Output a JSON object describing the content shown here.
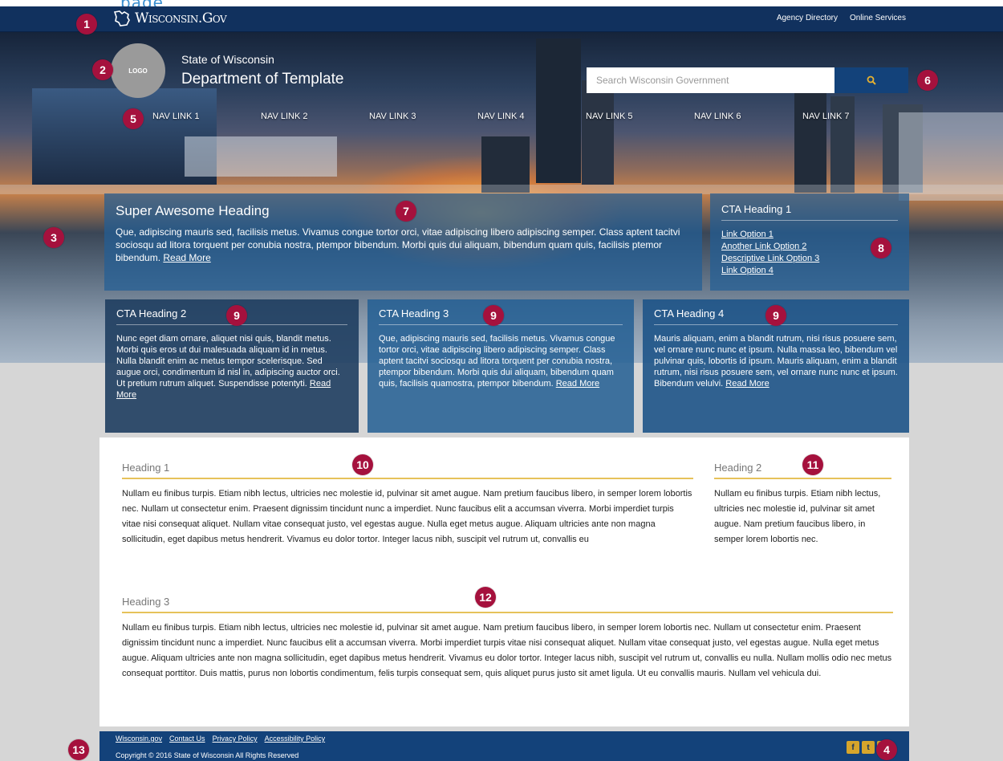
{
  "colors": {
    "top_bar": "#11315e",
    "accent_blue": "#13427a",
    "marker": "#a5113d",
    "heading_rule": "#e6c25a",
    "social_icon": "#d6a52b"
  },
  "brand": {
    "name": "Wisconsin.Gov",
    "icon": "wisconsin-state-outline-icon"
  },
  "top_links": [
    "Agency Directory",
    "Online Services"
  ],
  "header": {
    "logo_text": "LOGO",
    "state_name": "State of Wisconsin",
    "dept_name": "Department of Template"
  },
  "search": {
    "placeholder": "Search Wisconsin Government",
    "icon": "search-icon"
  },
  "nav": [
    "NAV LINK 1",
    "NAV LINK 2",
    "NAV LINK 3",
    "NAV LINK 4",
    "NAV LINK 5",
    "NAV LINK 6",
    "NAV LINK 7"
  ],
  "hero_panel": {
    "heading": "Super Awesome Heading",
    "body": "Que, adipiscing mauris sed, facilisis metus. Vivamus congue tortor orci, vitae adipiscing libero adipiscing semper. Class aptent tacitvi sociosqu ad litora torquent per conubia nostra, ptempor bibendum. Morbi quis dui aliquam, bibendum quam quis, facilisis ptemor bibendum. ",
    "read_more": "Read More"
  },
  "cta1": {
    "heading": "CTA Heading 1",
    "links": [
      "Link Option 1",
      "Another Link Option 2",
      "Descriptive Link Option 3",
      "Link Option 4"
    ]
  },
  "cta_cards": [
    {
      "heading": "CTA Heading 2",
      "body": "Nunc eget diam ornare, aliquet nisi quis, blandit metus. Morbi quis eros ut dui malesuada aliquam id in metus. Nulla blandit enim ac metus tempor scelerisque. Sed augue orci, condimentum id nisl in, adipiscing auctor orci. Ut pretium rutrum aliquet. Suspendisse potentyti. ",
      "read_more": "Read More"
    },
    {
      "heading": "CTA Heading 3",
      "body": "Que, adipiscing mauris sed, facilisis metus. Vivamus congue tortor orci, vitae adipiscing libero adipiscing semper. Class aptent tacitvi sociosqu ad litora torquent per conubia nostra, ptempor bibendum. Morbi quis dui aliquam, bibendum quam quis, facilisis quamostra, ptempor bibendum. ",
      "read_more": "Read More"
    },
    {
      "heading": "CTA Heading 4",
      "body": "Mauris aliquam, enim a blandit rutrum, nisi risus posuere sem, vel ornare nunc nunc et ipsum. Nulla massa leo, bibendum vel pulvinar quis, lobortis id ipsum. Mauris aliquam, enim a blandit rutrum, nisi risus posuere sem, vel ornare nunc nunc et ipsum. Bibendum velulvi. ",
      "read_more": "Read More"
    }
  ],
  "content": {
    "section1": {
      "heading": "Heading 1",
      "body": "Nullam eu finibus turpis. Etiam nibh lectus, ultricies nec molestie id, pulvinar sit amet augue. Nam pretium faucibus libero, in semper lorem lobortis nec. Nullam ut consectetur enim. Praesent dignissim tincidunt nunc a imperdiet. Nunc faucibus elit a accumsan viverra. Morbi imperdiet turpis vitae nisi consequat aliquet. Nullam vitae consequat justo, vel egestas augue. Nulla eget metus augue. Aliquam ultricies ante non magna sollicitudin, eget dapibus metus hendrerit. Vivamus eu dolor tortor. Integer lacus nibh, suscipit vel rutrum ut, convallis eu"
    },
    "section2": {
      "heading": "Heading 2",
      "body": "Nullam eu finibus turpis. Etiam nibh lectus, ultricies nec molestie id, pulvinar sit amet augue. Nam pretium faucibus libero, in semper lorem lobortis nec."
    },
    "section3": {
      "heading": "Heading 3",
      "body": "Nullam eu finibus turpis. Etiam nibh lectus, ultricies nec molestie id, pulvinar sit amet augue. Nam pretium faucibus libero, in semper lorem lobortis nec. Nullam ut consectetur enim. Praesent dignissim tincidunt nunc a imperdiet. Nunc faucibus elit a accumsan viverra. Morbi imperdiet turpis vitae nisi consequat aliquet. Nullam vitae consequat justo, vel egestas augue. Nulla eget metus augue. Aliquam ultricies ante non magna sollicitudin, eget dapibus metus hendrerit. Vivamus eu dolor tortor. Integer lacus nibh, suscipit vel rutrum ut, convallis eu nulla. Nullam mollis odio nec metus consequat porttitor. Duis mattis, purus non lobortis condimentum, felis turpis consequat sem, quis aliquet purus justo sit amet ligula. Ut eu convallis mauris. Nullam vel vehicula dui."
    }
  },
  "footer": {
    "links": [
      "Wisconsin.gov",
      "Contact Us",
      "Privacy Policy",
      "Accessibility Policy"
    ],
    "copyright": "Copyright © 2016 State of Wisconsin All Rights Reserved",
    "social": [
      {
        "icon": "facebook-icon",
        "glyph": "f"
      },
      {
        "icon": "twitter-icon",
        "glyph": "t"
      },
      {
        "icon": "youtube-icon",
        "glyph": "▶"
      }
    ]
  },
  "markers": [
    "1",
    "2",
    "3",
    "4",
    "5",
    "6",
    "7",
    "8",
    "9",
    "9",
    "9",
    "10",
    "11",
    "12",
    "13"
  ]
}
